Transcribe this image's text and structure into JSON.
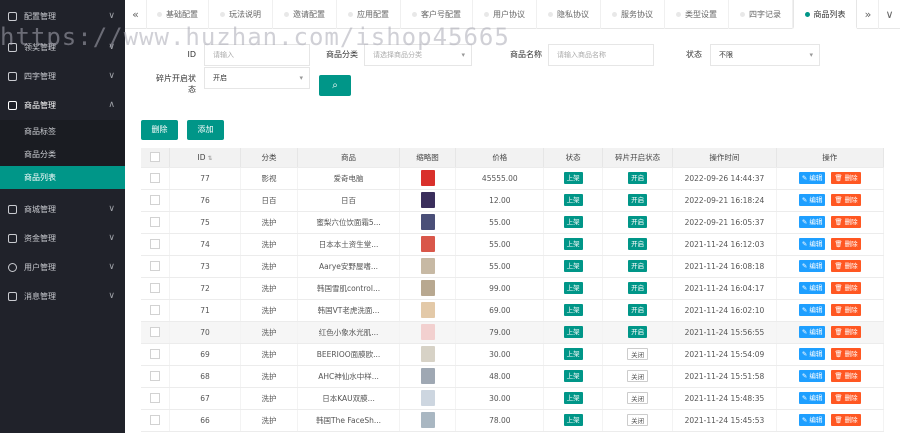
{
  "sidebar": {
    "items": [
      {
        "label": "配置管理",
        "arrow": "∨"
      },
      {
        "label": "领奖管理",
        "arrow": "∨"
      },
      {
        "label": "四字管理",
        "arrow": "∨"
      },
      {
        "label": "商品管理",
        "arrow": "∧"
      },
      {
        "label": "商城管理",
        "arrow": "∨"
      },
      {
        "label": "资金管理",
        "arrow": "∨"
      },
      {
        "label": "用户管理",
        "arrow": "∨"
      },
      {
        "label": "消息管理",
        "arrow": "∨"
      }
    ],
    "submenu": [
      {
        "label": "商品标签"
      },
      {
        "label": "商品分类"
      },
      {
        "label": "商品列表"
      }
    ]
  },
  "tabs": {
    "prev": "«",
    "next": "»",
    "more": "∨",
    "items": [
      {
        "label": "基础配置"
      },
      {
        "label": "玩法说明"
      },
      {
        "label": "邀请配置"
      },
      {
        "label": "应用配置"
      },
      {
        "label": "客户号配置"
      },
      {
        "label": "用户协议"
      },
      {
        "label": "隐私协议"
      },
      {
        "label": "服务协议"
      },
      {
        "label": "类型设置"
      },
      {
        "label": "四字记录"
      },
      {
        "label": "商品列表"
      }
    ]
  },
  "filters": {
    "id_label": "ID",
    "id_placeholder": "请输入",
    "category_label": "商品分类",
    "category_placeholder": "请选择商品分类",
    "name_label": "商品名称",
    "name_placeholder": "请输入商品名称",
    "status_label": "状态",
    "status_value": "不限",
    "fragment_label_line1": "碎片开启状",
    "fragment_label_line2": "态",
    "fragment_value": "开启",
    "search_icon": "⌕"
  },
  "actions": {
    "delete_label": "删除",
    "add_label": "添加"
  },
  "table": {
    "headers": {
      "id": "ID",
      "sort": "⇅",
      "category": "分类",
      "product": "商品",
      "thumb": "缩略图",
      "price": "价格",
      "status": "状态",
      "fragment": "碎片开启状态",
      "time": "操作时间",
      "ops": "操作"
    },
    "edit_label": "✎ 编辑",
    "delete_label": "🗑 删除",
    "rows": [
      {
        "id": "77",
        "category": "影视",
        "product": "爱奇电脑",
        "price": "45555.00",
        "status": "上架",
        "fragment": "开启",
        "fragment_on": true,
        "time": "2022-09-26 14:44:37",
        "thumb_color": "#d9302b"
      },
      {
        "id": "76",
        "category": "日百",
        "product": "日百",
        "price": "12.00",
        "status": "上架",
        "fragment": "开启",
        "fragment_on": true,
        "time": "2022-09-21 16:18:24",
        "thumb_color": "#3a2e5c"
      },
      {
        "id": "75",
        "category": "洗护",
        "product": "蜜梨六位饮面霜5...",
        "price": "55.00",
        "status": "上架",
        "fragment": "开启",
        "fragment_on": true,
        "time": "2022-09-21 16:05:37",
        "thumb_color": "#4a4f78"
      },
      {
        "id": "74",
        "category": "洗护",
        "product": "日本本土资生堂...",
        "price": "55.00",
        "status": "上架",
        "fragment": "开启",
        "fragment_on": true,
        "time": "2021-11-24 16:12:03",
        "thumb_color": "#d9574a"
      },
      {
        "id": "73",
        "category": "洗护",
        "product": "Aarye安野屋嗜...",
        "price": "55.00",
        "status": "上架",
        "fragment": "开启",
        "fragment_on": true,
        "time": "2021-11-24 16:08:18",
        "thumb_color": "#c7b9a4"
      },
      {
        "id": "72",
        "category": "洗护",
        "product": "韩国雪肌control...",
        "price": "99.00",
        "status": "上架",
        "fragment": "开启",
        "fragment_on": true,
        "time": "2021-11-24 16:04:17",
        "thumb_color": "#b8a890"
      },
      {
        "id": "71",
        "category": "洗护",
        "product": "韩国VT老虎洗面...",
        "price": "69.00",
        "status": "上架",
        "fragment": "开启",
        "fragment_on": true,
        "time": "2021-11-24 16:02:10",
        "thumb_color": "#e3c9a8"
      },
      {
        "id": "70",
        "category": "洗护",
        "product": "红色小象水光肌...",
        "price": "79.00",
        "status": "上架",
        "fragment": "开启",
        "fragment_on": true,
        "time": "2021-11-24 15:56:55",
        "thumb_color": "#f2d0cf"
      },
      {
        "id": "69",
        "category": "洗护",
        "product": "BEERIOO面膜欧...",
        "price": "30.00",
        "status": "上架",
        "fragment": "关闭",
        "fragment_on": false,
        "time": "2021-11-24 15:54:09",
        "thumb_color": "#d7d2c6"
      },
      {
        "id": "68",
        "category": "洗护",
        "product": "AHC神仙水中样...",
        "price": "48.00",
        "status": "上架",
        "fragment": "关闭",
        "fragment_on": false,
        "time": "2021-11-24 15:51:58",
        "thumb_color": "#9fa8b3"
      },
      {
        "id": "67",
        "category": "洗护",
        "product": "日本KAU双膜...",
        "price": "30.00",
        "status": "上架",
        "fragment": "关闭",
        "fragment_on": false,
        "time": "2021-11-24 15:48:35",
        "thumb_color": "#cdd6e0"
      },
      {
        "id": "66",
        "category": "洗护",
        "product": "韩国The FaceSh...",
        "price": "78.00",
        "status": "上架",
        "fragment": "关闭",
        "fragment_on": false,
        "time": "2021-11-24 15:45:53",
        "thumb_color": "#a9b7c2"
      }
    ]
  },
  "watermark": "https://www.huzhan.com/ishop45665",
  "colors": {
    "sidebar_bg": "#20222a",
    "accent": "#009688",
    "edit": "#1e9fff",
    "delete": "#ff5722"
  }
}
